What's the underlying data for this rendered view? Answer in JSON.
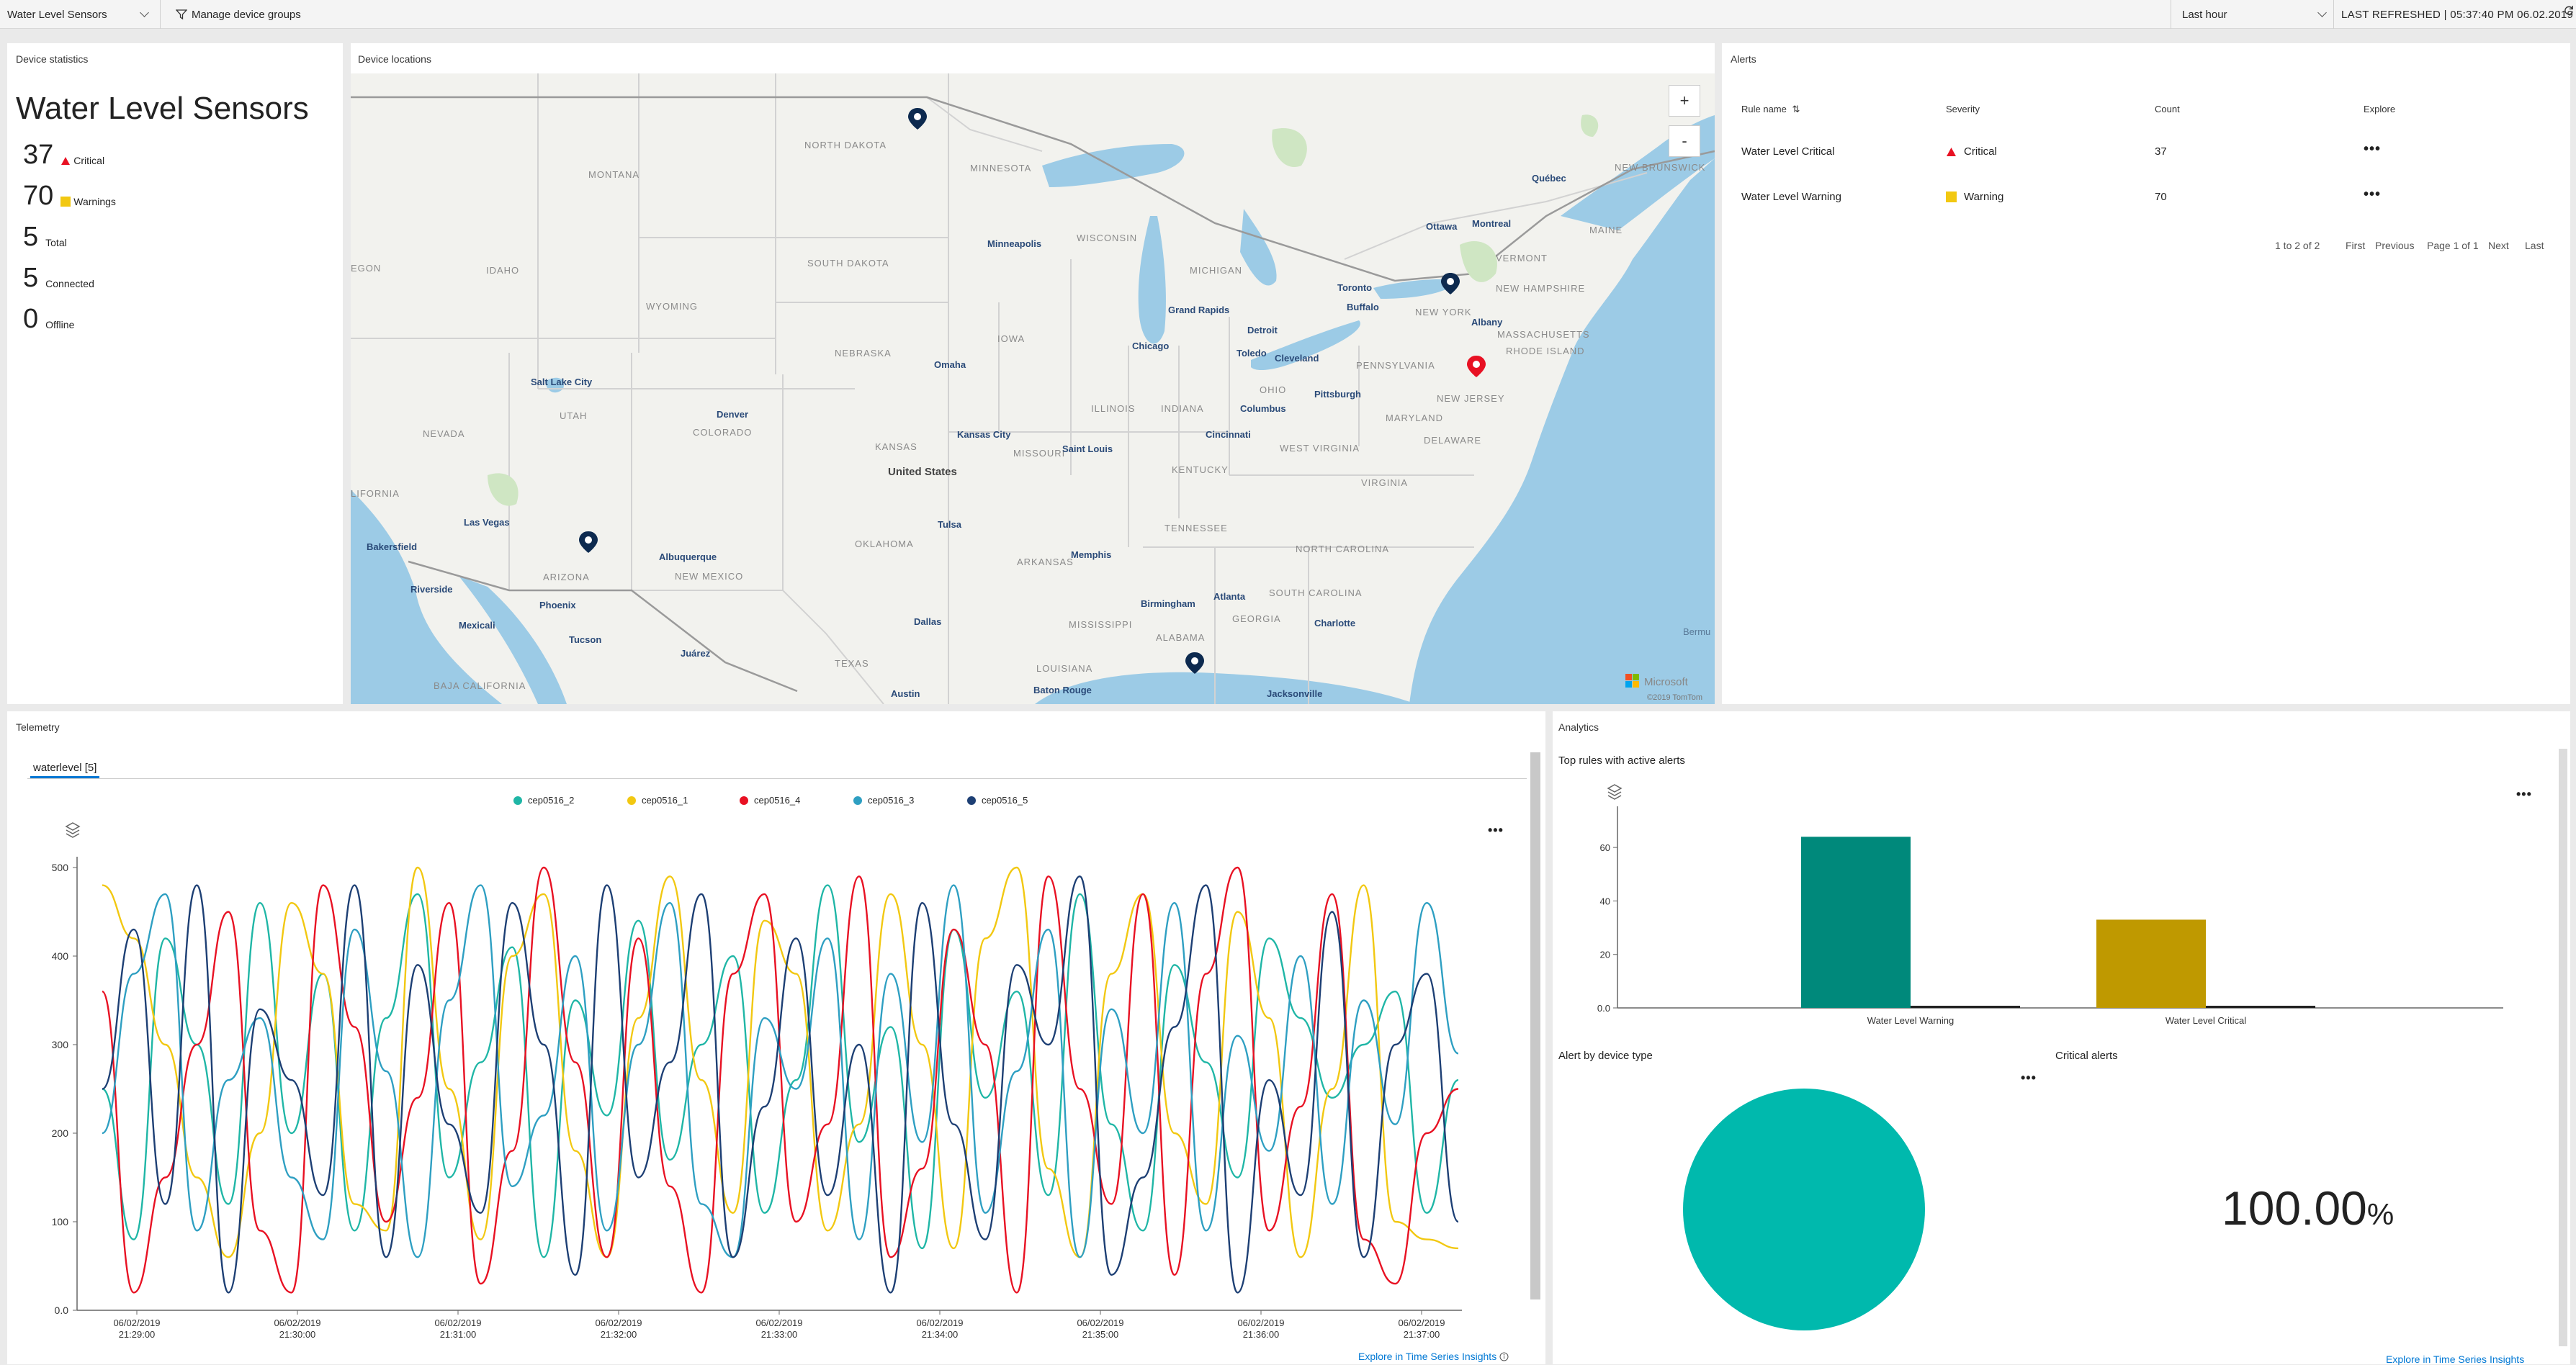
{
  "topbar": {
    "device_group": "Water Level Sensors",
    "manage_groups": "Manage device groups",
    "time_range": "Last hour",
    "last_refreshed": "LAST REFRESHED | 05:37:40 PM 06.02.2019"
  },
  "device_stats": {
    "title": "Device statistics",
    "group_name": "Water Level Sensors",
    "critical_count": "37",
    "critical_label": "Critical",
    "warnings_count": "70",
    "warnings_label": "Warnings",
    "total_count": "5",
    "total_label": "Total",
    "connected_count": "5",
    "connected_label": "Connected",
    "offline_count": "0",
    "offline_label": "Offline"
  },
  "map": {
    "title": "Device locations",
    "zoom_in": "+",
    "zoom_out": "-",
    "attribution_brand": "Microsoft",
    "attribution": "©2019 TomTom",
    "labels": {
      "montana": "MONTANA",
      "north_dakota": "NORTH DAKOTA",
      "minnesota": "MINNESOTA",
      "south_dakota": "SOUTH DAKOTA",
      "wisconsin": "WISCONSIN",
      "michigan": "MICHIGAN",
      "idaho": "IDAHO",
      "wyoming": "WYOMING",
      "nebraska": "NEBRASKA",
      "iowa": "IOWA",
      "illinois": "ILLINOIS",
      "indiana": "INDIANA",
      "ohio": "OHIO",
      "pennsylvania": "PENNSYLVANIA",
      "new_york": "NEW YORK",
      "vermont": "VERMONT",
      "new_hampshire": "NEW HAMPSHIRE",
      "maine": "MAINE",
      "massachusetts": "MASSACHUSETTS",
      "rhode_island": "RHODE ISLAND",
      "new_jersey": "NEW JERSEY",
      "maryland": "MARYLAND",
      "delaware": "DELAWARE",
      "nevada": "NEVADA",
      "utah": "UTAH",
      "colorado": "COLORADO",
      "kansas": "KANSAS",
      "missouri": "MISSOURI",
      "kentucky": "KENTUCKY",
      "west_virginia": "WEST VIRGINIA",
      "virginia": "VIRGINIA",
      "california": "LIFORNIA",
      "arizona": "ARIZONA",
      "new_mexico": "NEW MEXICO",
      "oklahoma": "OKLAHOMA",
      "arkansas": "ARKANSAS",
      "tennessee": "TENNESSEE",
      "north_carolina": "NORTH CAROLINA",
      "south_carolina": "SOUTH CAROLINA",
      "georgia": "GEORGIA",
      "alabama": "ALABAMA",
      "mississippi": "MISSISSIPPI",
      "louisiana": "LOUISIANA",
      "texas": "TEXAS",
      "baja": "BAJA CALIFORNIA",
      "oregon": "EGON",
      "new_brunswick": "NEW BRUNSWICK",
      "united_states": "United States",
      "minneapolis": "Minneapolis",
      "grand_rapids": "Grand Rapids",
      "detroit": "Detroit",
      "toronto": "Toronto",
      "buffalo": "Buffalo",
      "ottawa": "Ottawa",
      "montreal": "Montreal",
      "quebec": "Québec",
      "albany": "Albany",
      "chicago": "Chicago",
      "toledo": "Toledo",
      "cleveland": "Cleveland",
      "pittsburgh": "Pittsburgh",
      "columbus": "Columbus",
      "cincinnati": "Cincinnati",
      "omaha": "Omaha",
      "denver": "Denver",
      "salt_lake": "Salt Lake City",
      "kansas_city": "Kansas City",
      "saint_louis": "Saint Louis",
      "tulsa": "Tulsa",
      "memphis": "Memphis",
      "las_vegas": "Las Vegas",
      "albuquerque": "Albuquerque",
      "bakersfield": "Bakersfield",
      "riverside": "Riverside",
      "phoenix": "Phoenix",
      "tucson": "Tucson",
      "mexicali": "Mexicali",
      "juarez": "Juárez",
      "dallas": "Dallas",
      "austin": "Austin",
      "baton_rouge": "Baton Rouge",
      "birmingham": "Birmingham",
      "atlanta": "Atlanta",
      "charlotte": "Charlotte",
      "jacksonville": "Jacksonville",
      "bermuda": "Bermu"
    }
  },
  "alerts": {
    "title": "Alerts",
    "headers": [
      "Rule name",
      "Severity",
      "Count",
      "Explore"
    ],
    "sort_icon": "⇅",
    "rows": [
      {
        "rule": "Water Level Critical",
        "severity": "Critical",
        "count": "37",
        "explore": "•••"
      },
      {
        "rule": "Water Level Warning",
        "severity": "Warning",
        "count": "70",
        "explore": "•••"
      }
    ],
    "pager": {
      "range": "1 to 2 of 2",
      "first": "First",
      "previous": "Previous",
      "page": "Page 1 of 1",
      "next": "Next",
      "last": "Last"
    }
  },
  "telemetry": {
    "title": "Telemetry",
    "tab": "waterlevel [5]",
    "more": "•••",
    "link": "Explore in Time Series Insights",
    "legend": [
      {
        "name": "cep0516_2",
        "color": "#1fb6a6"
      },
      {
        "name": "cep0516_1",
        "color": "#f2c811"
      },
      {
        "name": "cep0516_4",
        "color": "#e81123"
      },
      {
        "name": "cep0516_3",
        "color": "#2e9fc2"
      },
      {
        "name": "cep0516_5",
        "color": "#1d3f74"
      }
    ]
  },
  "analytics": {
    "title": "Analytics",
    "top_rules_title": "Top rules with active alerts",
    "more": "•••",
    "alert_by_type_title": "Alert by device type",
    "critical_alerts_title": "Critical alerts",
    "critical_pct_value": "100.00",
    "critical_pct_unit": "%",
    "link": "Explore in Time Series Insights",
    "colors": {
      "warning_bar": "#00897b",
      "critical_bar": "#bf9900",
      "pie": "#00b9ad"
    }
  },
  "chart_data": [
    {
      "type": "line",
      "title": "",
      "xlabel": "",
      "ylabel": "",
      "ylim": [
        0,
        500
      ],
      "x": [
        "06/02/2019 21:29:00",
        "06/02/2019 21:30:00",
        "06/02/2019 21:31:00",
        "06/02/2019 21:32:00",
        "06/02/2019 21:33:00",
        "06/02/2019 21:34:00",
        "06/02/2019 21:35:00",
        "06/02/2019 21:36:00",
        "06/02/2019 21:37:00"
      ],
      "y_ticks": [
        "0.0",
        "100",
        "200",
        "300",
        "400",
        "500"
      ],
      "series": [
        {
          "name": "cep0516_2",
          "color": "#1fb6a6",
          "values": [
            250,
            80,
            420,
            300,
            120,
            460,
            200,
            380,
            90,
            330,
            470,
            150,
            280,
            410,
            60,
            350,
            220,
            440,
            170,
            300,
            400,
            110,
            260,
            480,
            190,
            320,
            70,
            430,
            240,
            360,
            130,
            470,
            210,
            90,
            390,
            280,
            150,
            420,
            330,
            240,
            300,
            360,
            110,
            260
          ]
        },
        {
          "name": "cep0516_1",
          "color": "#f2c811",
          "values": [
            480,
            420,
            300,
            150,
            60,
            200,
            460,
            380,
            120,
            90,
            500,
            250,
            80,
            400,
            470,
            180,
            60,
            330,
            490,
            260,
            110,
            440,
            380,
            90,
            210,
            470,
            300,
            70,
            420,
            500,
            160,
            60,
            380,
            470,
            200,
            120,
            450,
            330,
            60,
            250,
            480,
            100,
            80,
            70
          ]
        },
        {
          "name": "cep0516_4",
          "color": "#e81123",
          "values": [
            360,
            20,
            150,
            300,
            450,
            90,
            20,
            480,
            320,
            100,
            240,
            460,
            30,
            180,
            500,
            280,
            60,
            420,
            140,
            20,
            380,
            470,
            100,
            210,
            490,
            60,
            160,
            430,
            300,
            20,
            490,
            250,
            120,
            470,
            40,
            380,
            500,
            90,
            230,
            470,
            80,
            30,
            200,
            250
          ]
        },
        {
          "name": "cep0516_3",
          "color": "#2e9fc2",
          "values": [
            200,
            380,
            470,
            90,
            260,
            330,
            150,
            80,
            430,
            270,
            60,
            350,
            480,
            140,
            220,
            400,
            90,
            300,
            460,
            120,
            60,
            330,
            250,
            420,
            80,
            380,
            190,
            480,
            110,
            270,
            430,
            60,
            340,
            200,
            460,
            90,
            310,
            180,
            400,
            120,
            350,
            210,
            460,
            290
          ]
        },
        {
          "name": "cep0516_5",
          "color": "#1d3f74",
          "values": [
            250,
            430,
            120,
            480,
            20,
            340,
            260,
            130,
            480,
            60,
            390,
            210,
            110,
            460,
            300,
            40,
            480,
            150,
            280,
            470,
            60,
            230,
            420,
            130,
            300,
            20,
            460,
            210,
            80,
            390,
            300,
            490,
            40,
            150,
            320,
            480,
            20,
            260,
            130,
            450,
            60,
            300,
            380,
            100
          ]
        }
      ]
    },
    {
      "type": "bar",
      "title": "",
      "categories": [
        "Water Level Warning",
        "Water Level Critical"
      ],
      "values": [
        64,
        33
      ],
      "ylim": [
        0,
        70
      ],
      "y_ticks": [
        "0.0",
        "20",
        "40",
        "60"
      ]
    },
    {
      "type": "pie",
      "title": "",
      "categories": [
        "Water Level Sensors"
      ],
      "values": [
        100
      ]
    }
  ]
}
